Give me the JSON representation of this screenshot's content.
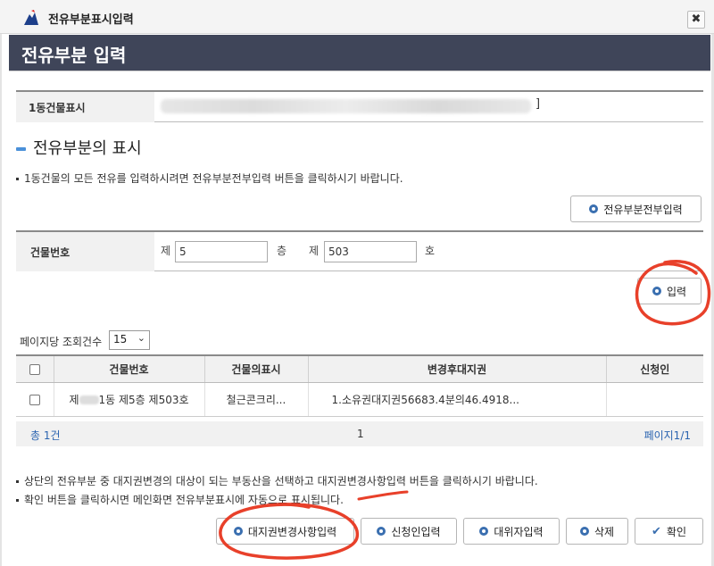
{
  "window": {
    "title": "전유부분표시입력",
    "close_label": "✖"
  },
  "header": {
    "page_title": "전유부분 입력"
  },
  "building": {
    "label": "1동건물표시",
    "value_suffix": "]"
  },
  "section": {
    "title": "전유부분의 표시"
  },
  "notice1": "1동건물의 모든 전유를 입력하시려면 전유부분전부입력 버튼을 클릭하시기 바랍니다.",
  "buttons": {
    "all_input": "전유부분전부입력",
    "input": "입력",
    "rights_change": "대지권변경사항입력",
    "applicant": "신청인입력",
    "agent": "대위자입력",
    "delete": "삭제",
    "confirm": "확인"
  },
  "building_number": {
    "label": "건물번호",
    "floor_prefix": "제",
    "floor_value": "5",
    "floor_suffix": "층",
    "room_prefix": "제",
    "room_value": "503",
    "room_suffix": "호"
  },
  "list": {
    "per_page_label": "페이지당 조회건수",
    "per_page_value": "15",
    "columns": [
      "건물번호",
      "건물의표시",
      "변경후대지권",
      "신청인"
    ],
    "rows": [
      {
        "bldg_prefix": "제",
        "bldg_rest": "1동 제5층 제503호",
        "display": "철근콘크리...",
        "rights": "1.소유권대지권56683.4분의46.4918...",
        "applicant": ""
      }
    ],
    "total": "총 1건",
    "page": "1",
    "page_of": "페이지1/1"
  },
  "notice2": "상단의 전유부분 중 대지권변경의 대상이 되는 부동산을 선택하고 대지권변경사항입력 버튼을 클릭하시기 바랍니다.",
  "notice3": "확인 버튼을 클릭하시면 메인화면 전유부분표시에 자동으로 표시됩니다.",
  "colors": {
    "header_bg": "#3f4559",
    "accent_blue": "#3a6fb0",
    "annotation_red": "#e8402a"
  },
  "icons": [
    "app-icon",
    "close-icon",
    "ring-icon",
    "check-icon",
    "chevron-down-icon"
  ]
}
